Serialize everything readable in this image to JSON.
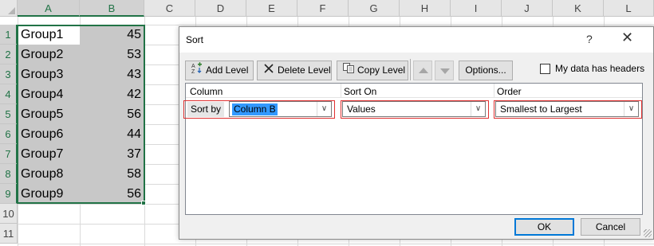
{
  "spreadsheet": {
    "columns": [
      "A",
      "B",
      "C",
      "D",
      "E",
      "F",
      "G",
      "H",
      "I",
      "J",
      "K",
      "L"
    ],
    "rows": [
      "1",
      "2",
      "3",
      "4",
      "5",
      "6",
      "7",
      "8",
      "9",
      "10",
      "11"
    ],
    "data": [
      {
        "label": "Group1",
        "value": "45"
      },
      {
        "label": "Group2",
        "value": "53"
      },
      {
        "label": "Group3",
        "value": "43"
      },
      {
        "label": "Group4",
        "value": "42"
      },
      {
        "label": "Group5",
        "value": "56"
      },
      {
        "label": "Group6",
        "value": "44"
      },
      {
        "label": "Group7",
        "value": "37"
      },
      {
        "label": "Group8",
        "value": "58"
      },
      {
        "label": "Group9",
        "value": "56"
      }
    ]
  },
  "dialog": {
    "title": "Sort",
    "help": "?",
    "close": "✕",
    "toolbar": {
      "add_level": "Add Level",
      "delete_level": "Delete Level",
      "copy_level": "Copy Level",
      "options": "Options...",
      "my_data_has_headers": "My data has headers"
    },
    "headers": {
      "column": "Column",
      "sort_on": "Sort On",
      "order": "Order"
    },
    "level": {
      "label": "Sort by",
      "column": "Column B",
      "sort_on": "Values",
      "order": "Smallest to Largest"
    },
    "ok": "OK",
    "cancel": "Cancel"
  },
  "colors": {
    "excel_green": "#217346",
    "selection_gray": "#c8c8c8",
    "highlight_blue": "#3399ff",
    "callout_red": "#e03030"
  }
}
